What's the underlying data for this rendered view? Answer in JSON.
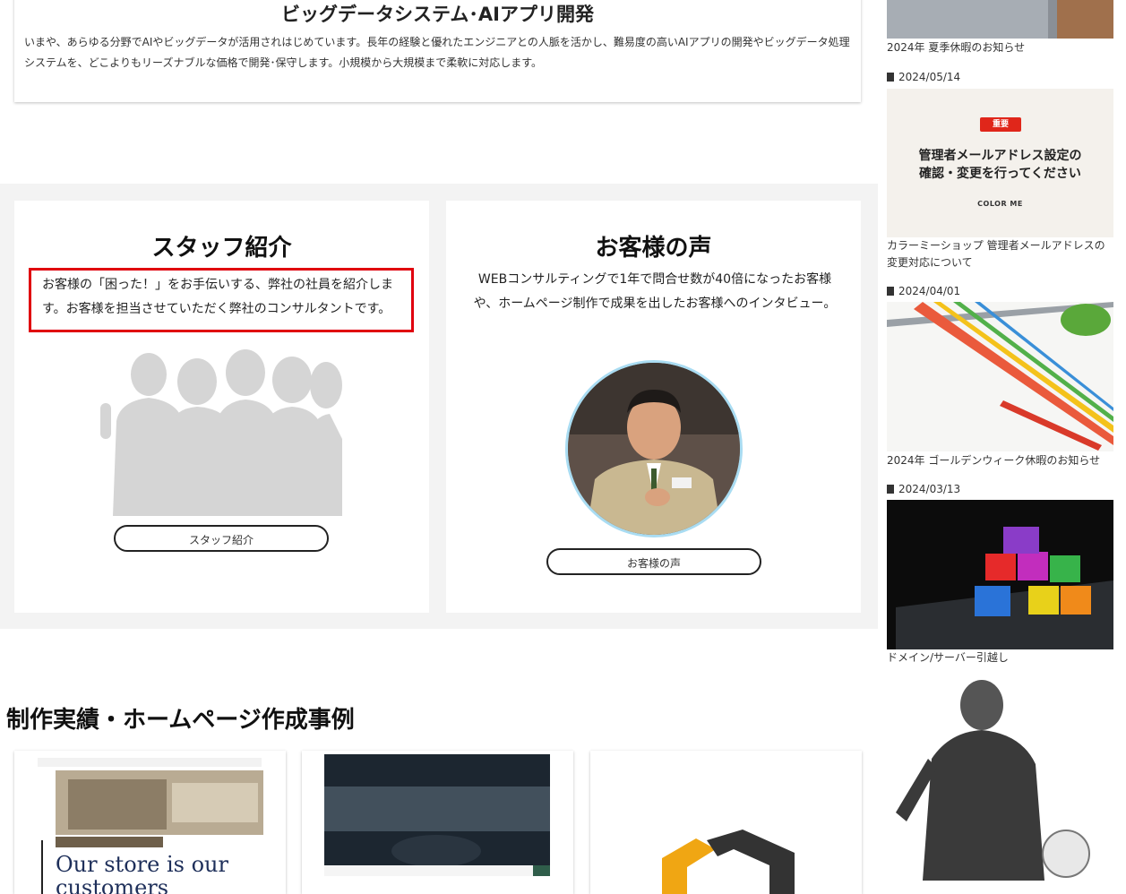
{
  "service": {
    "title": "ビッグデータシステム･AIアプリ開発",
    "text": "いまや、あらゆる分野でAIやビッグデータが活用されはじめています。長年の経験と優れたエンジニアとの人脈を活かし、難易度の高いAIアプリの開発やビッグデータ処理システムを、どこよりもリーズナブルな価格で開発･保守します。小規模から大規模まで柔軟に対応します。"
  },
  "staff": {
    "title": "スタッフ紹介",
    "text": "お客様の「困った！」をお手伝いする、弊社の社員を紹介します。お客様を担当させていただく弊社のコンサルタントです。",
    "button": "スタッフ紹介"
  },
  "voice": {
    "title": "お客様の声",
    "text": "WEBコンサルティングで1年で問合せ数が40倍になったお客様や、ホームページ制作で成果を出したお客様へのインタビュー。",
    "button": "お客様の声"
  },
  "works": {
    "title": "制作実績・ホームページ作成事例",
    "item1_text": "Our store is our customers"
  },
  "sidebar": {
    "news": [
      {
        "date": "",
        "caption": "2024年 夏季休暇のお知らせ"
      },
      {
        "date": "2024/05/14",
        "caption": "カラーミーショップ 管理者メールアドレスの変更対応について",
        "img_badge": "重要",
        "img_line1": "管理者メールアドレス設定の",
        "img_line2": "確認・変更を行ってください",
        "img_logo": "COLOR ME"
      },
      {
        "date": "2024/04/01",
        "caption": "2024年 ゴールデンウィーク休暇のお知らせ"
      },
      {
        "date": "2024/03/13",
        "caption": "ドメイン/サーバー引越し"
      }
    ]
  },
  "colors": {
    "highlight_border": "#e0000e",
    "band": "#f3f3f3",
    "avatar_ring": "#a9dcf2"
  }
}
